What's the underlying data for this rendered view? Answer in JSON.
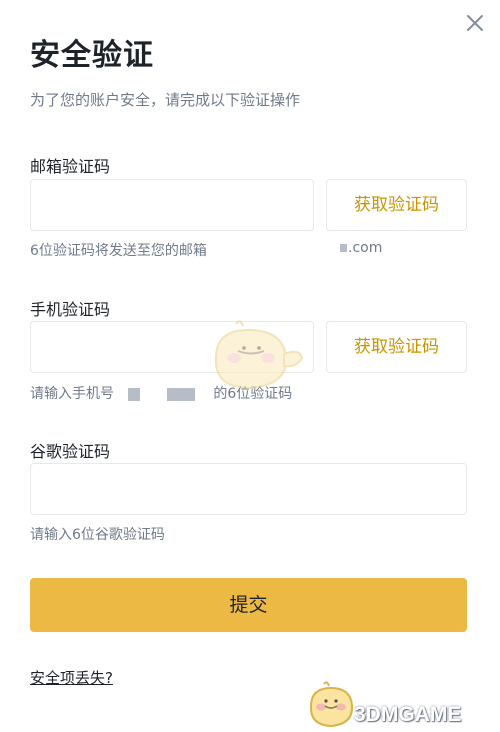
{
  "dialog": {
    "title": "安全验证",
    "subtitle": "为了您的账户安全，请完成以下验证操作"
  },
  "email": {
    "label": "邮箱验证码",
    "input_value": "",
    "get_code_label": "获取验证码",
    "hint": "6位验证码将发送至您的邮箱",
    "hint_suffix": ".com"
  },
  "phone": {
    "label": "手机验证码",
    "input_value": "",
    "get_code_label": "获取验证码",
    "hint_prefix": "请输入手机号",
    "hint_suffix": "的6位验证码"
  },
  "google": {
    "label": "谷歌验证码",
    "input_value": "",
    "hint": "请输入6位谷歌验证码"
  },
  "actions": {
    "submit_label": "提交",
    "lost_link": "安全项丢失?"
  },
  "watermark": {
    "text": "3DMGAME"
  },
  "colors": {
    "accent": "#ebb944",
    "accent_text": "#c99400",
    "muted_text": "#707a8a",
    "border": "#e6e8ea"
  },
  "icons": {
    "close": "close-icon"
  }
}
